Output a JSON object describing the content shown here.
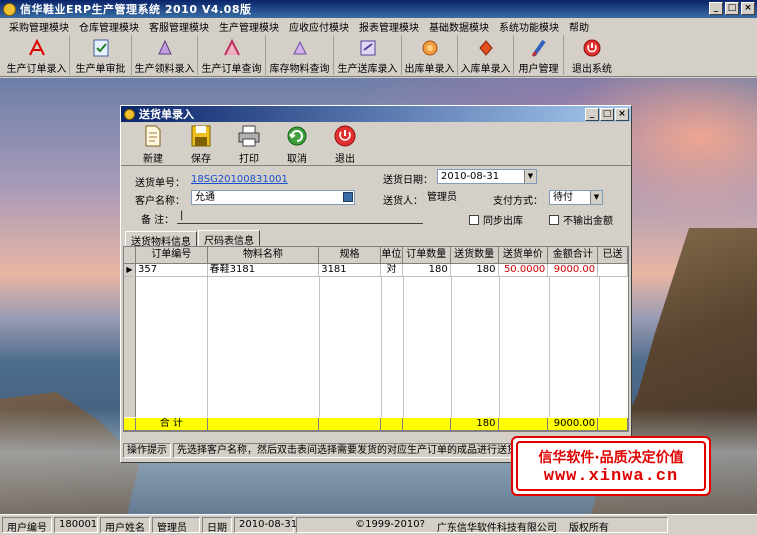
{
  "window": {
    "title": "信华鞋业ERP生产管理系统  2010 V4.08版"
  },
  "menu": [
    "采购管理模块",
    "仓库管理模块",
    "客服管理模块",
    "生产管理模块",
    "应收应付模块",
    "报表管理模块",
    "基础数据模块",
    "系统功能模块",
    "帮助"
  ],
  "toolbar": [
    {
      "label": "生产订单录入",
      "icon": "pdf-icon"
    },
    {
      "label": "生产单审批",
      "icon": "approve-icon"
    },
    {
      "label": "生产领料录入",
      "icon": "material-icon"
    },
    {
      "label": "生产订单查询",
      "icon": "query-icon"
    },
    {
      "label": "库存物料查询",
      "icon": "stock-icon"
    },
    {
      "label": "生产送库录入",
      "icon": "delivery-icon"
    },
    {
      "label": "出库单录入",
      "icon": "outbound-icon"
    },
    {
      "label": "入库单录入",
      "icon": "inbound-icon"
    },
    {
      "label": "用户管理",
      "icon": "user-icon"
    },
    {
      "label": "退出系统",
      "icon": "exit-icon"
    }
  ],
  "dialog": {
    "title": "送货单录入",
    "toolbar": [
      {
        "label": "新建",
        "icon": "new-icon"
      },
      {
        "label": "保存",
        "icon": "save-icon"
      },
      {
        "label": "打印",
        "icon": "print-icon"
      },
      {
        "label": "取消",
        "icon": "cancel-icon"
      },
      {
        "label": "退出",
        "icon": "exit-icon"
      }
    ],
    "form": {
      "order_no_label": "送货单号：",
      "order_no": "18SG20100831001",
      "date_label": "送货日期：",
      "date": "2010-08-31",
      "customer_label": "客户名称：",
      "customer": "允通",
      "deliverer_label": "送货人：",
      "deliverer": "管理员",
      "payment_label": "支付方式：",
      "payment": "待付",
      "remark_label": "备  注：",
      "remark": "|",
      "sync_label": "同步出库",
      "no_amount_label": "不输出金额"
    },
    "tabs": [
      "送货物料信息",
      "尺码表信息"
    ],
    "grid": {
      "columns": [
        "订单编号",
        "物料名称",
        "规格",
        "单位",
        "订单数量",
        "送货数量",
        "送货单价",
        "金额合计",
        "已送"
      ],
      "rows": [
        {
          "order": "357",
          "material": "春鞋3181",
          "spec": "3181",
          "unit": "对",
          "order_qty": "180",
          "delivery_qty": "180",
          "price": "50.0000",
          "amount": "9000.00",
          "sent": ""
        }
      ],
      "total_label": "合 计",
      "total_delivery_qty": "180",
      "total_amount": "9000.00"
    },
    "hint_caption": "操作提示",
    "hint_text": "先选择客户名称，然后双击表间选择需要发货的对应生产订单的成品进行送货操作。"
  },
  "status": {
    "user_no_label": "用户编号",
    "user_no": "180001",
    "user_name_label": "用户姓名",
    "user_name": "管理员",
    "date_label": "日期",
    "date": "2010-08-31",
    "copyright": "©1999-2010?",
    "company": "广东信华软件科技有限公司",
    "rights": "版权所有"
  },
  "promo": {
    "line1": "信华软件·品质决定价值",
    "line2": "www.xinwa.cn"
  },
  "colors": {
    "title_bar": "#0a246a",
    "total_row": "#ffff00",
    "price_text": "#d40000",
    "promo_red": "#e00000"
  }
}
